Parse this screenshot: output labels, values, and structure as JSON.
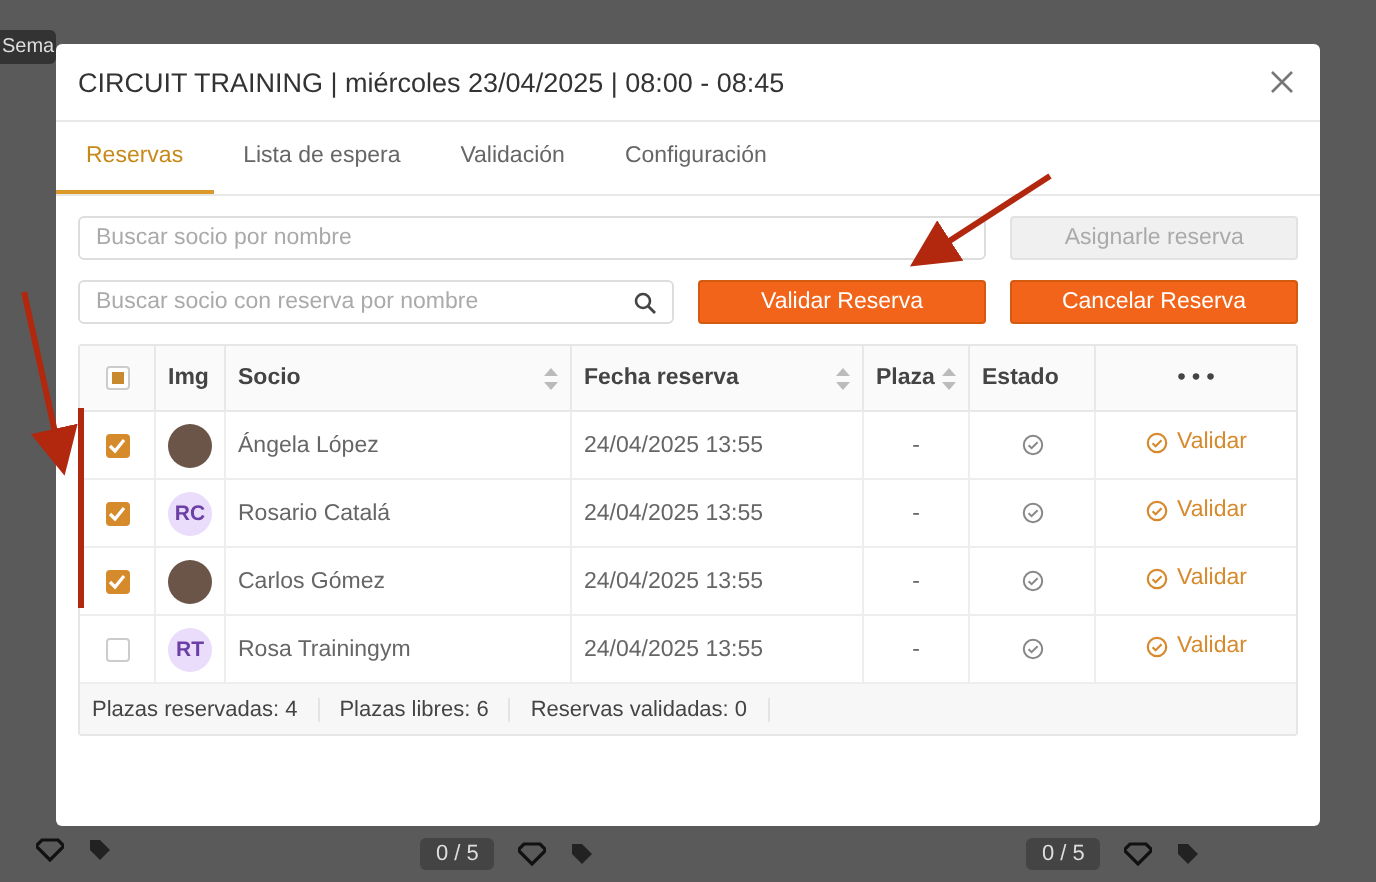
{
  "background": {
    "view_button": "Sema",
    "slot_counts": [
      "0 / 5",
      "0 / 5"
    ]
  },
  "modal": {
    "title": "CIRCUIT TRAINING | miércoles 23/04/2025 | 08:00 - 08:45",
    "tabs": [
      {
        "label": "Reservas",
        "selected": true
      },
      {
        "label": "Lista de espera",
        "selected": false
      },
      {
        "label": "Validación",
        "selected": false
      },
      {
        "label": "Configuración",
        "selected": false
      }
    ],
    "member_search": {
      "placeholder": "Buscar socio por nombre"
    },
    "assign_button": {
      "label": "Asignarle reserva",
      "disabled": true
    },
    "booking_search": {
      "placeholder": "Buscar socio con reserva por nombre"
    },
    "validate_button": {
      "label": "Validar Reserva",
      "disabled": false
    },
    "cancel_button": {
      "label": "Cancelar Reserva",
      "disabled": false
    },
    "table": {
      "select_all_partial": true,
      "columns": [
        {
          "label": "Img",
          "sortable": false
        },
        {
          "label": "Socio",
          "sortable": true
        },
        {
          "label": "Fecha reserva",
          "sortable": true
        },
        {
          "label": "Plaza",
          "sortable": true
        },
        {
          "label": "Estado",
          "sortable": false
        },
        {
          "label": "• • •",
          "sortable": false
        }
      ],
      "rows": [
        {
          "checked": true,
          "avatar": {
            "kind": "photo"
          },
          "name": "Ángela López",
          "date": "24/04/2025 13:55",
          "plaza": "-",
          "action": "Validar"
        },
        {
          "checked": true,
          "avatar": {
            "kind": "initials",
            "initials": "RC"
          },
          "name": "Rosario Catalá",
          "date": "24/04/2025 13:55",
          "plaza": "-",
          "action": "Validar"
        },
        {
          "checked": true,
          "avatar": {
            "kind": "photo"
          },
          "name": "Carlos Gómez",
          "date": "24/04/2025 13:55",
          "plaza": "-",
          "action": "Validar"
        },
        {
          "checked": false,
          "avatar": {
            "kind": "initials",
            "initials": "RT"
          },
          "name": "Rosa Trainingym",
          "date": "24/04/2025 13:55",
          "plaza": "-",
          "action": "Validar"
        }
      ],
      "footer": [
        "Plazas reservadas: 4",
        "Plazas libres: 6",
        "Reservas validadas: 0"
      ]
    }
  }
}
